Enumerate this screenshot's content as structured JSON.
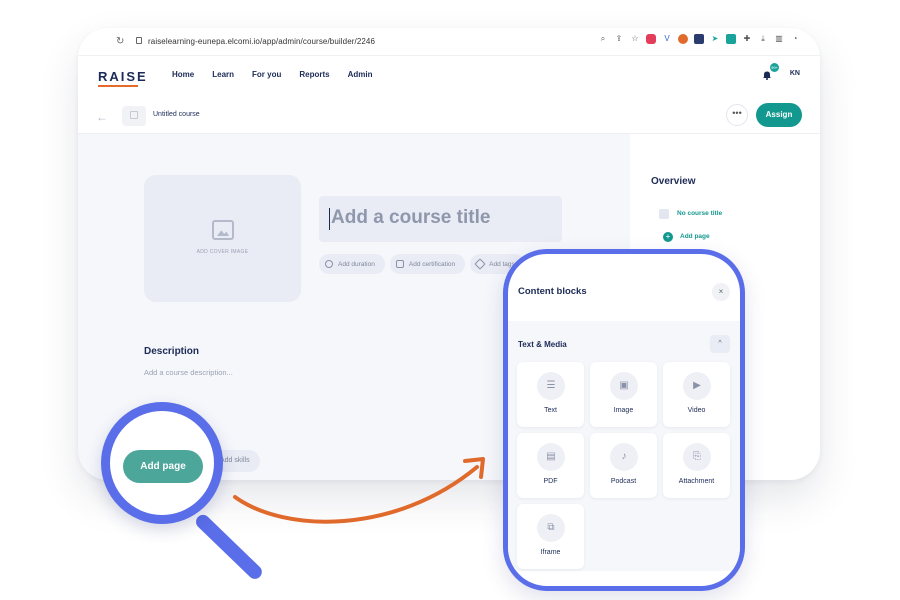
{
  "browser": {
    "url": "raiselearning-eunepa.elcomi.io/app/admin/course/builder/2246"
  },
  "app": {
    "logo": "RAISE",
    "nav": [
      "Home",
      "Learn",
      "For you",
      "Reports",
      "Admin"
    ],
    "bell_badge": "99+",
    "user_initials": "KN"
  },
  "subbar": {
    "course_name": "Untitled course",
    "more_label": "•••",
    "assign_label": "Assign"
  },
  "editor": {
    "cover_label": "ADD COVER IMAGE",
    "title_placeholder": "Add a course title",
    "chips": [
      "Add duration",
      "Add certification",
      "Add tags"
    ],
    "description_heading": "Description",
    "description_placeholder": "Add a course description...",
    "add_skills": "Add skills"
  },
  "overview": {
    "title": "Overview",
    "items": [
      "No course title"
    ],
    "add_page": "Add page"
  },
  "magnifier": {
    "button_label": "Add page"
  },
  "panel": {
    "title": "Content blocks",
    "close_icon": "×",
    "section": "Text & Media",
    "collapse_icon": "^",
    "blocks": [
      {
        "label": "Text",
        "icon": "text-icon",
        "glyph": "☰"
      },
      {
        "label": "Image",
        "icon": "image-icon",
        "glyph": "▣"
      },
      {
        "label": "Video",
        "icon": "video-icon",
        "glyph": "▶"
      },
      {
        "label": "PDF",
        "icon": "pdf-icon",
        "glyph": "▤"
      },
      {
        "label": "Podcast",
        "icon": "podcast-icon",
        "glyph": "♪"
      },
      {
        "label": "Attachment",
        "icon": "attachment-icon",
        "glyph": "⎘"
      },
      {
        "label": "Iframe",
        "icon": "iframe-icon",
        "glyph": "⧉"
      }
    ]
  },
  "colors": {
    "accent": "#13988f",
    "magnifier": "#5b6ee9",
    "arrow": "#e06a2c"
  }
}
